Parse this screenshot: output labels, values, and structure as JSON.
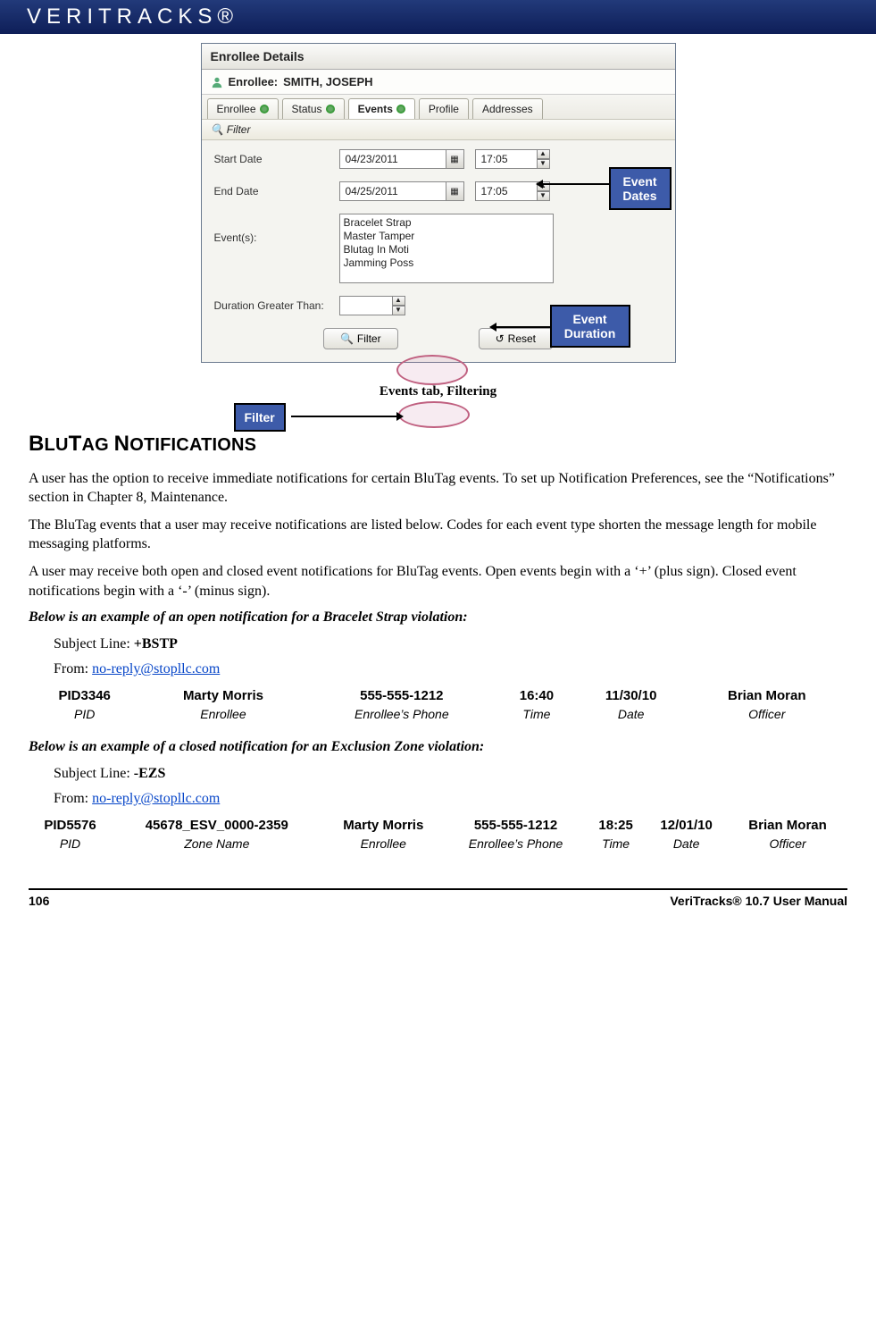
{
  "brand": "VERITRACKS®",
  "window": {
    "title": "Enrollee Details",
    "enrollee_label": "Enrollee:",
    "enrollee_name": "SMITH, JOSEPH",
    "tabs": [
      "Enrollee",
      "Status",
      "Events",
      "Profile",
      "Addresses"
    ],
    "filter_header": "Filter",
    "labels": {
      "start_date": "Start Date",
      "end_date": "End Date",
      "events": "Event(s):",
      "duration": "Duration Greater Than:"
    },
    "values": {
      "start_date": "04/23/2011",
      "start_time": "17:05",
      "end_date": "04/25/2011",
      "end_time": "17:05",
      "duration": ""
    },
    "event_list": [
      "Bracelet Strap",
      "Master Tamper",
      "Blutag In Moti",
      "Jamming Poss"
    ],
    "buttons": {
      "filter": "Filter",
      "reset": "Reset"
    }
  },
  "callouts": {
    "dates": "Event Dates",
    "duration": "Event Duration",
    "filter": "Filter"
  },
  "caption": "Events tab, Filtering",
  "section_heading": "BLUTAG NOTIFICATIONS",
  "para1": "A user has the option to receive immediate notifications for certain BluTag events. To set up Notification Preferences, see the “Notifications” section in Chapter 8, Maintenance.",
  "para2": "The BluTag events that a user may receive notifications are listed below. Codes for each event type shorten the message length for mobile messaging platforms.",
  "para3": "A user may receive both open and closed event notifications for BluTag events. Open events begin with a ‘+’ (plus sign). Closed event notifications begin with a ‘-’ (minus sign).",
  "example1_intro": "Below is an example of an open notification for a Bracelet Strap violation:",
  "ex1_subject_label": "Subject Line: ",
  "ex1_subject_value": "+BSTP",
  "ex1_from_label": "From: ",
  "ex1_from_value": "no-reply@stopllc.com",
  "table1": {
    "row": [
      "PID3346",
      "Marty Morris",
      "555-555-1212",
      "16:40",
      "11/30/10",
      "Brian Moran"
    ],
    "labels": [
      "PID",
      "Enrollee",
      "Enrollee’s Phone",
      "Time",
      "Date",
      "Officer"
    ]
  },
  "example2_intro": "Below is an example of a closed notification for an Exclusion Zone violation:",
  "ex2_subject_label": "Subject Line: ",
  "ex2_subject_value": "-EZS",
  "ex2_from_label": "From: ",
  "ex2_from_value": "no-reply@stopllc.com",
  "table2": {
    "row": [
      "PID5576",
      "45678_ESV_0000-2359",
      "Marty Morris",
      "555-555-1212",
      "18:25",
      "12/01/10",
      "Brian Moran"
    ],
    "labels": [
      "PID",
      "Zone Name",
      "Enrollee",
      "Enrollee’s Phone",
      "Time",
      "Date",
      "Officer"
    ]
  },
  "footer": {
    "page": "106",
    "manual": "VeriTracks® 10.7 User Manual"
  }
}
